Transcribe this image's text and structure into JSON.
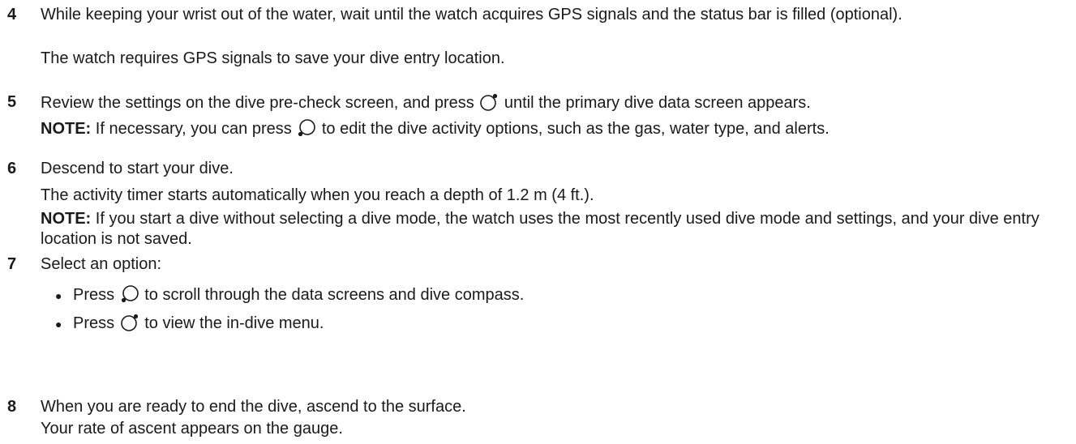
{
  "steps": [
    {
      "number": "4",
      "text_a": "While keeping your wrist out of the water, wait until the watch acquires GPS signals and the status bar is filled (optional).",
      "sub": "The watch requires GPS signals to save your dive entry location."
    },
    {
      "number": "5",
      "text_before": "Review the settings on the dive pre-check screen, and press",
      "text_after": "until the primary dive data screen appears.",
      "note_label": "NOTE:",
      "note_before": "If necessary, you can press",
      "note_after": "to edit the dive activity options, such as the gas, water type, and alerts."
    },
    {
      "number": "6",
      "text": "Descend to start your dive.",
      "sub": "The activity timer starts automatically when you reach a depth of 1.2 m (4 ft.).",
      "note_label": "NOTE:",
      "note_text": "If you start a dive without selecting a dive mode, the watch uses the most recently used dive mode and settings, and your dive entry location is not saved."
    },
    {
      "number": "7",
      "text": "Select an option:",
      "options": [
        {
          "before": "Press",
          "after": "to scroll through the data screens and dive compass."
        },
        {
          "before": "Press",
          "after": "to view the in-dive menu."
        }
      ]
    },
    {
      "number": "8",
      "text": "When you are ready to end the dive, ascend to the surface.",
      "sub": "Your rate of ascent appears on the gauge."
    }
  ],
  "icons": {
    "start_button": "watch-upper-right-button-icon",
    "down_button": "watch-lower-left-button-icon"
  }
}
